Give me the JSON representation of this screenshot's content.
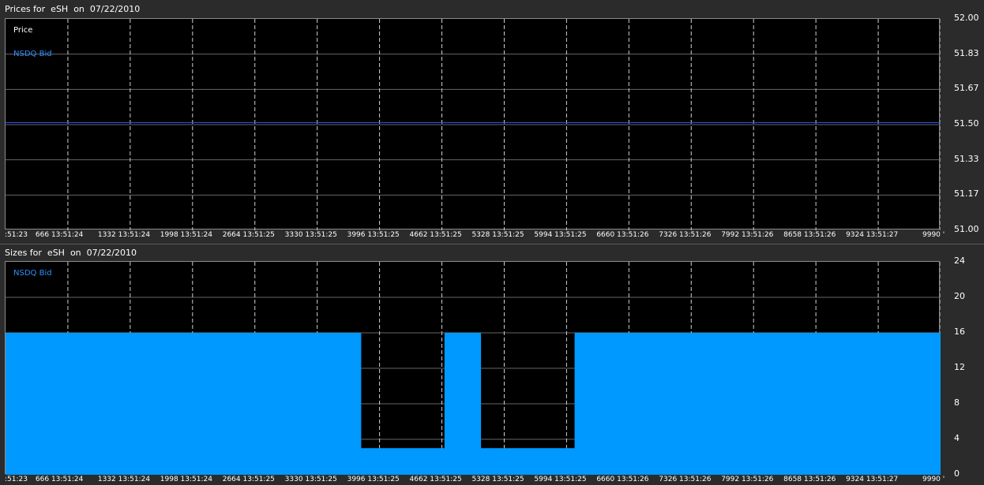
{
  "colors": {
    "background": "#2b2b2b",
    "plot_bg": "#000000",
    "price_line": "#3355ff",
    "size_fill": "#0099ff",
    "bid_label": "#2f8fff",
    "grid": "#666666"
  },
  "panels": {
    "prices": {
      "title": "Prices for  eSH  on  07/22/2010"
    },
    "sizes": {
      "title": "Sizes for  eSH  on  07/22/2010"
    }
  },
  "chart_data": [
    {
      "type": "line",
      "title": "Prices for  eSH  on  07/22/2010",
      "label": "Price",
      "series": [
        {
          "name": "NSDQ Bid",
          "x": [
            0,
            9990
          ],
          "values": [
            51.51,
            51.51
          ]
        }
      ],
      "ylim": [
        51.0,
        52.0
      ],
      "yticks": [
        "52.00",
        "51.83",
        "51.67",
        "51.50",
        "51.33",
        "51.17",
        "51.00"
      ],
      "xlim": [
        0,
        9990
      ],
      "xticks": [
        ":51:23",
        "666 13:51:24",
        "1332 13:51:24",
        "1998 13:51:24",
        "2664 13:51:25",
        "3330 13:51:25",
        "3996 13:51:25",
        "4662 13:51:25",
        "5328 13:51:25",
        "5994 13:51:25",
        "6660 13:51:26",
        "7326 13:51:26",
        "7992 13:51:26",
        "8658 13:51:26",
        "9324 13:51:27",
        "9990 '"
      ],
      "grid": true
    },
    {
      "type": "area",
      "title": "Sizes for  eSH  on  07/22/2010",
      "series": [
        {
          "name": "NSDQ Bid",
          "x": [
            0,
            3800,
            3800,
            4690,
            4690,
            5080,
            5080,
            6080,
            6080,
            9990
          ],
          "values": [
            16,
            16,
            3,
            3,
            16,
            16,
            3,
            3,
            16,
            16
          ]
        }
      ],
      "ylim": [
        0,
        24
      ],
      "yticks": [
        "24",
        "20",
        "16",
        "12",
        "8",
        "4",
        "0"
      ],
      "xlim": [
        0,
        9990
      ],
      "xticks": [
        ":51:23",
        "666 13:51:24",
        "1332 13:51:24",
        "1998 13:51:24",
        "2664 13:51:25",
        "3330 13:51:25",
        "3996 13:51:25",
        "4662 13:51:25",
        "5328 13:51:25",
        "5994 13:51:25",
        "6660 13:51:26",
        "7326 13:51:26",
        "7992 13:51:26",
        "8658 13:51:26",
        "9324 13:51:27",
        "9990 '"
      ],
      "grid": true
    }
  ]
}
